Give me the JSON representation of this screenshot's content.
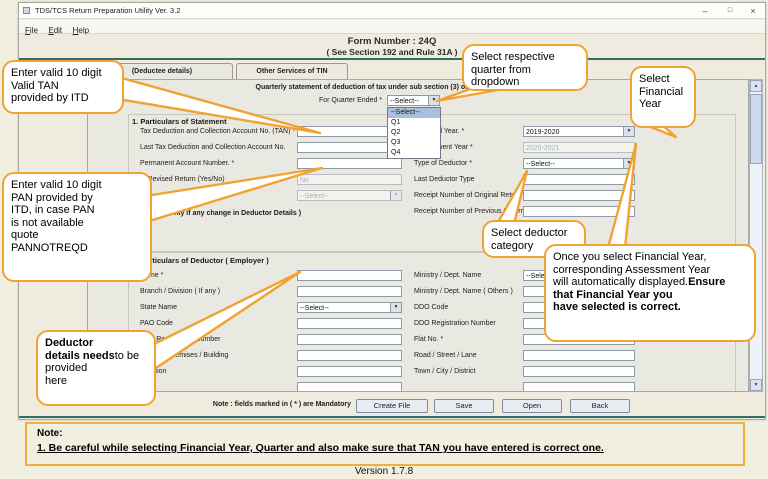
{
  "colors": {
    "accent_orange": "#F0A330",
    "teal_line": "#336F60",
    "panel_gray": "#E9E8E1"
  },
  "window": {
    "title": "TDS/TCS Return Preparation Utility Ver. 3.2",
    "menu": {
      "file": "File",
      "edit": "Edit",
      "help": "Help"
    },
    "controls": {
      "minimize": "–",
      "restore": "□",
      "close": "×"
    }
  },
  "header": {
    "form_number": "Form Number : 24Q",
    "rule": "( See Section 192 and Rule 31A )"
  },
  "tabs": {
    "deductee": "(Deductee details)",
    "other_services": "Other Services of TIN"
  },
  "form": {
    "caption": "Quarterly statement of deduction of tax under sub section (3) of section 200 of the Income-tax Act",
    "quarter_label": "For Quarter Ended *",
    "quarter_value": "--Select--",
    "quarter_options": [
      "--Select--",
      "Q1",
      "Q2",
      "Q3",
      "Q4"
    ],
    "s1_title": "1. Particulars of Statement",
    "s1": {
      "tan_label": "Tax Deduction and Collection Account No. (TAN) *",
      "tan_value": "",
      "last_tan_label": "Last Tax Deduction and Collection Account No.",
      "last_tan_value": "",
      "pan_label": "Permanent Account Number. *",
      "pan_value": "",
      "revised_label": "Is Revised Return (Yes/No)",
      "revised_value": "No",
      "revised_type_value": "--Select--",
      "update_note": "( Update only if any change in Deductor Details )",
      "fy_label": "Financial Year. *",
      "fy_value": "2019-2020",
      "ay_label": "Assessment Year *",
      "ay_value": "2020-2021",
      "deductor_type_label": "Type of Deductor *",
      "deductor_type_value": "--Select--",
      "last_deductor_label": "Last Deductor Type",
      "last_deductor_value": "",
      "receipt_original_label": "Receipt Number of Original Return",
      "receipt_original_value": "",
      "receipt_previous_label": "Receipt Number of Previous Return",
      "receipt_previous_value": ""
    },
    "s2_title": "2. Particulars of Deductor ( Employer )",
    "s2": {
      "name_label": "Name *",
      "branch_label": "Branch / Division ( If any )",
      "state_label": "State Name",
      "state_value": "--Select--",
      "pao_code_label": "PAO Code",
      "pao_reg_label": "PAO Registration Number",
      "premises_label": "Name of Premises / Building",
      "location_label": "Location",
      "ministry_label": "Ministry / Dept. Name",
      "ministry_value": "--Select--",
      "ministry_others_label": "Ministry / Dept. Name ( Others )",
      "ddo_code_label": "DDO Code",
      "ddo_reg_label": "DDO Registration Number",
      "flat_label": "Flat No. *",
      "road_label": "Road / Street / Lane",
      "town_label": "Town / City / District"
    },
    "mandatory_note": "Note : fields marked in ( * ) are Mandatory",
    "buttons": {
      "create": "Create File",
      "save": "Save",
      "open": "Open",
      "back": "Back"
    }
  },
  "callouts": {
    "tan": "Enter valid 10 digit\nValid TAN\nprovided by ITD",
    "pan": "Enter valid 10 digit\nPAN provided by\nITD, in case PAN\nis not available\nquote\nPANNOTREQD",
    "deductor_bold": "Deductor\ndetails needs",
    "deductor_rest": "to be provided\nhere",
    "quarter": "Select respective\nquarter from\ndropdown",
    "fy": "Select\nFinancial\nYear",
    "category": "Select deductor\ncategory",
    "fy_auto": "Once you select Financial Year,\ncorresponding Assessment Year\nwill automatically displayed.",
    "fy_auto_bold": "Ensure that Financial Year you\nhave selected is correct."
  },
  "note_box": {
    "title": "Note:",
    "line1": "1. Be careful while selecting Financial Year, Quarter and also make sure that TAN you have entered is correct one."
  },
  "version": "Version 1.7.8"
}
